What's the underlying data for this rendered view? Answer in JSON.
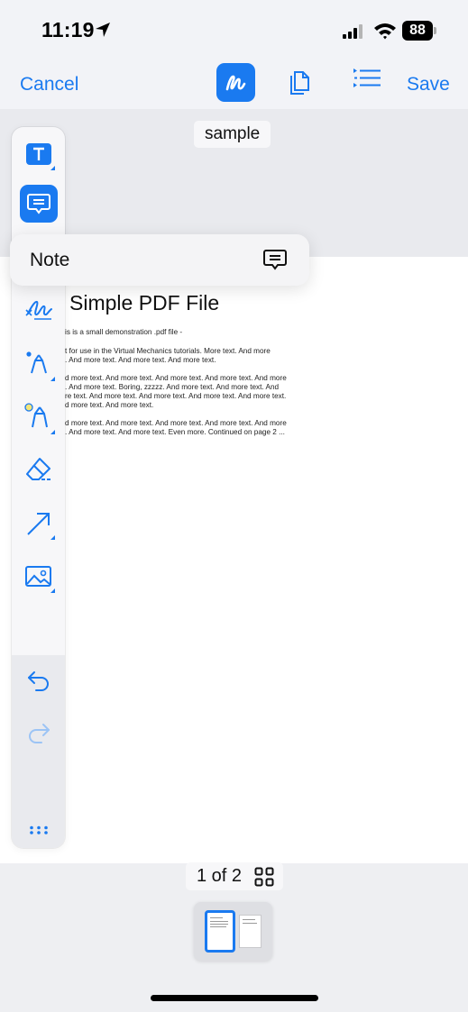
{
  "status": {
    "time": "11:19",
    "battery": "88"
  },
  "nav": {
    "cancel": "Cancel",
    "save": "Save"
  },
  "document": {
    "name": "sample",
    "title": "Simple PDF File",
    "lines": [
      "is is a small demonstration .pdf file -",
      "t for use in the Virtual Mechanics tutorials. More text. And more",
      ". And more text. And more text. And more text.",
      "d more text. And more text. And more text. And more text. And more",
      ". And more text. Boring, zzzzz. And more text. And more text. And",
      "re text. And more text. And more text. And more text. And more text.",
      "d more text. And more text.",
      "d more text. And more text. And more text. And more text. And more",
      ". And more text. And more text. Even more. Continued on page 2 ..."
    ]
  },
  "popup": {
    "label": "Note"
  },
  "pager": {
    "text": "1 of 2"
  },
  "colors": {
    "accent": "#1a7af0"
  },
  "toolbar_icons": [
    "text-icon",
    "note-icon",
    "signature-icon",
    "pen-icon",
    "highlighter-icon",
    "eraser-icon",
    "arrow-icon",
    "image-icon",
    "undo-icon",
    "redo-icon",
    "more-icon"
  ]
}
